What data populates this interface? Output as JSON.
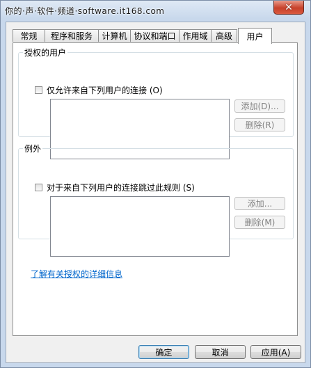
{
  "watermark": "你的·声·软件·频道·software.it168.com",
  "tabs": [
    "常规",
    "程序和服务",
    "计算机",
    "协议和端口",
    "作用域",
    "高级",
    "用户"
  ],
  "active_tab": 6,
  "authorized": {
    "legend": "授权的用户",
    "checkbox_label": "仅允许来自下列用户的连接 (O)",
    "add_button": "添加(D)...",
    "remove_button": "删除(R)"
  },
  "exceptions": {
    "legend": "例外",
    "checkbox_label": "对于来自下列用户的连接跳过此规则 (S)",
    "add_button": "添加...",
    "remove_button": "删除(M)"
  },
  "link": "了解有关授权的详细信息",
  "footer": {
    "ok": "确定",
    "cancel": "取消",
    "apply": "应用(A)"
  },
  "close_glyph": "✕"
}
